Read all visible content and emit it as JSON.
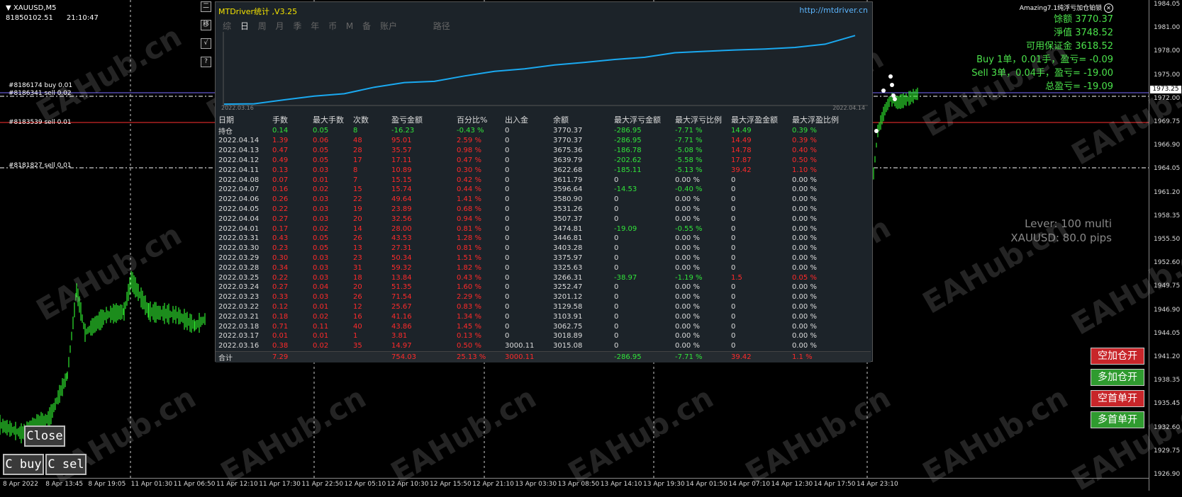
{
  "chart": {
    "symbol": "XAUUSD,M5",
    "account": "81850102.51",
    "time": "21:10:47",
    "watermark": "EAHub.cn",
    "price_ticks": [
      "1984.05",
      "1981.00",
      "1978.00",
      "1975.00",
      "1972.00",
      "1969.75",
      "1966.90",
      "1964.05",
      "1961.20",
      "1958.35",
      "1955.50",
      "1952.60",
      "1949.75",
      "1946.90",
      "1944.05",
      "1941.20",
      "1938.35",
      "1935.45",
      "1932.60",
      "1929.75",
      "1926.90"
    ],
    "current_price_tag": "1973.25",
    "time_ticks": [
      "8 Apr 2022",
      "8 Apr 13:45",
      "8 Apr 19:05",
      "11 Apr 01:30",
      "11 Apr 06:50",
      "11 Apr 12:10",
      "11 Apr 17:30",
      "11 Apr 22:50",
      "12 Apr 05:10",
      "12 Apr 10:30",
      "12 Apr 15:50",
      "12 Apr 21:10",
      "13 Apr 03:30",
      "13 Apr 08:50",
      "13 Apr 14:10",
      "13 Apr 19:30",
      "14 Apr 01:50",
      "14 Apr 07:10",
      "14 Apr 12:30",
      "14 Apr 17:50",
      "14 Apr 23:10"
    ],
    "levels": [
      {
        "label": "#8186174 buy 0.01",
        "color": "#7a6cff"
      },
      {
        "label": "#8186341 sell 0.02",
        "color": "#ffffff"
      },
      {
        "label": "#8183539 sell 0.01",
        "color": "#ff3030"
      },
      {
        "label": "#8181827 sell 0.01",
        "color": "#ffffff"
      }
    ],
    "mini_buttons": [
      "二",
      "移",
      "√",
      "?"
    ]
  },
  "panel": {
    "title": "MTDriver统计 ,V3.25",
    "link": "http://mtdriver.cn",
    "tabs": [
      "综",
      "日",
      "周",
      "月",
      "季",
      "年",
      "币",
      "M",
      "备",
      "账户",
      "路径"
    ],
    "active_tab": "日",
    "date_start": "2022.03.16",
    "date_end": "2022.04.14",
    "balance_curve": [
      3015.08,
      3018.89,
      3062.75,
      3103.91,
      3129.58,
      3201.12,
      3252.47,
      3266.31,
      3325.63,
      3375.97,
      3403.28,
      3446.81,
      3474.81,
      3507.37,
      3531.26,
      3580.9,
      3596.64,
      3611.79,
      3622.68,
      3639.79,
      3675.36,
      3770.37
    ],
    "headers": [
      "日期",
      "手数",
      "最大手数",
      "次数",
      "盈亏金额",
      "百分比%",
      "出入金",
      "余额",
      "最大浮亏金额",
      "最大浮亏比例",
      "最大浮盈金额",
      "最大浮盈比例"
    ],
    "rows": [
      [
        "持仓",
        "0.14",
        "0.05",
        "8",
        "-16.23",
        "-0.43 %",
        "0",
        "3770.37",
        "-286.95",
        "-7.71 %",
        "14.49",
        "0.39 %"
      ],
      [
        "2022.04.14",
        "1.39",
        "0.06",
        "48",
        "95.01",
        "2.59 %",
        "0",
        "3770.37",
        "-286.95",
        "-7.71 %",
        "14.49",
        "0.39 %"
      ],
      [
        "2022.04.13",
        "0.47",
        "0.05",
        "28",
        "35.57",
        "0.98 %",
        "0",
        "3675.36",
        "-186.78",
        "-5.08 %",
        "14.78",
        "0.40 %"
      ],
      [
        "2022.04.12",
        "0.49",
        "0.05",
        "17",
        "17.11",
        "0.47 %",
        "0",
        "3639.79",
        "-202.62",
        "-5.58 %",
        "17.87",
        "0.50 %"
      ],
      [
        "2022.04.11",
        "0.13",
        "0.03",
        "8",
        "10.89",
        "0.30 %",
        "0",
        "3622.68",
        "-185.11",
        "-5.13 %",
        "39.42",
        "1.10 %"
      ],
      [
        "2022.04.08",
        "0.07",
        "0.01",
        "7",
        "15.15",
        "0.42 %",
        "0",
        "3611.79",
        "0",
        "0.00 %",
        "0",
        "0.00 %"
      ],
      [
        "2022.04.07",
        "0.16",
        "0.02",
        "15",
        "15.74",
        "0.44 %",
        "0",
        "3596.64",
        "-14.53",
        "-0.40 %",
        "0",
        "0.00 %"
      ],
      [
        "2022.04.06",
        "0.26",
        "0.03",
        "22",
        "49.64",
        "1.41 %",
        "0",
        "3580.90",
        "0",
        "0.00 %",
        "0",
        "0.00 %"
      ],
      [
        "2022.04.05",
        "0.22",
        "0.03",
        "19",
        "23.89",
        "0.68 %",
        "0",
        "3531.26",
        "0",
        "0.00 %",
        "0",
        "0.00 %"
      ],
      [
        "2022.04.04",
        "0.27",
        "0.03",
        "20",
        "32.56",
        "0.94 %",
        "0",
        "3507.37",
        "0",
        "0.00 %",
        "0",
        "0.00 %"
      ],
      [
        "2022.04.01",
        "0.17",
        "0.02",
        "14",
        "28.00",
        "0.81 %",
        "0",
        "3474.81",
        "-19.09",
        "-0.55 %",
        "0",
        "0.00 %"
      ],
      [
        "2022.03.31",
        "0.43",
        "0.05",
        "26",
        "43.53",
        "1.28 %",
        "0",
        "3446.81",
        "0",
        "0.00 %",
        "0",
        "0.00 %"
      ],
      [
        "2022.03.30",
        "0.23",
        "0.05",
        "13",
        "27.31",
        "0.81 %",
        "0",
        "3403.28",
        "0",
        "0.00 %",
        "0",
        "0.00 %"
      ],
      [
        "2022.03.29",
        "0.30",
        "0.03",
        "23",
        "50.34",
        "1.51 %",
        "0",
        "3375.97",
        "0",
        "0.00 %",
        "0",
        "0.00 %"
      ],
      [
        "2022.03.28",
        "0.34",
        "0.03",
        "31",
        "59.32",
        "1.82 %",
        "0",
        "3325.63",
        "0",
        "0.00 %",
        "0",
        "0.00 %"
      ],
      [
        "2022.03.25",
        "0.22",
        "0.03",
        "18",
        "13.84",
        "0.43 %",
        "0",
        "3266.31",
        "-38.97",
        "-1.19 %",
        "1.5",
        "0.05 %"
      ],
      [
        "2022.03.24",
        "0.27",
        "0.04",
        "20",
        "51.35",
        "1.60 %",
        "0",
        "3252.47",
        "0",
        "0.00 %",
        "0",
        "0.00 %"
      ],
      [
        "2022.03.23",
        "0.33",
        "0.03",
        "26",
        "71.54",
        "2.29 %",
        "0",
        "3201.12",
        "0",
        "0.00 %",
        "0",
        "0.00 %"
      ],
      [
        "2022.03.22",
        "0.12",
        "0.01",
        "12",
        "25.67",
        "0.83 %",
        "0",
        "3129.58",
        "0",
        "0.00 %",
        "0",
        "0.00 %"
      ],
      [
        "2022.03.21",
        "0.18",
        "0.02",
        "16",
        "41.16",
        "1.34 %",
        "0",
        "3103.91",
        "0",
        "0.00 %",
        "0",
        "0.00 %"
      ],
      [
        "2022.03.18",
        "0.71",
        "0.11",
        "40",
        "43.86",
        "1.45 %",
        "0",
        "3062.75",
        "0",
        "0.00 %",
        "0",
        "0.00 %"
      ],
      [
        "2022.03.17",
        "0.01",
        "0.01",
        "1",
        "3.81",
        "0.13 %",
        "0",
        "3018.89",
        "0",
        "0.00 %",
        "0",
        "0.00 %"
      ],
      [
        "2022.03.16",
        "0.38",
        "0.02",
        "35",
        "14.97",
        "0.50 %",
        "3000.11",
        "3015.08",
        "0",
        "0.00 %",
        "0",
        "0.00 %"
      ]
    ],
    "total": [
      "合计",
      "7.29",
      "",
      "",
      "754.03",
      "25.13 %",
      "3000.11",
      "",
      "-286.95",
      "-7.71 %",
      "39.42",
      "1.1 %"
    ]
  },
  "right_info": {
    "ea_name": "Amazing7.1纯浮亏加仓铂锁",
    "lines": [
      "馀额 3770.37",
      "淨值 3748.52",
      "可用保证金 3618.52",
      "Buy 1单，0.01手，盈亏= -0.09",
      "Sell 3单，0.04手，盈亏= -19.00",
      "总盈亏= -19.09"
    ],
    "lever": "Lever: 100 multi",
    "pips": "XAUUSD: 80.0 pips"
  },
  "buttons": {
    "short_add": "空加仓开",
    "long_add": "多加仓开",
    "short_first": "空首单开",
    "long_first": "多首单开",
    "close": "Close",
    "c_buy": "C buy",
    "c_sell": "C sel"
  },
  "colors": {
    "panel_bg": "#1c2329",
    "curve": "#1aa9f0",
    "candles": "#2ee82e",
    "positive": "#dcdcdc",
    "negative": "#ff2a2a",
    "green": "#31e53a"
  }
}
